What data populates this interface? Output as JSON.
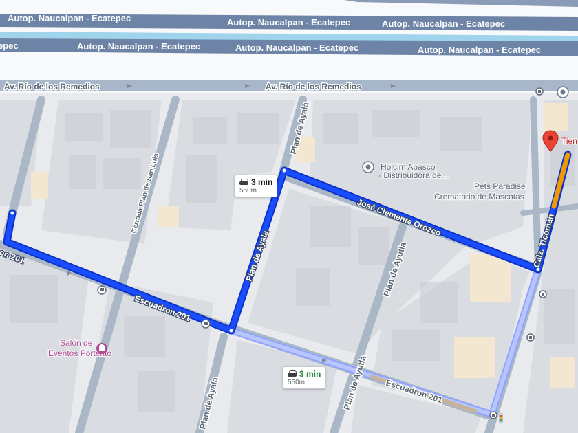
{
  "highway": {
    "label": "Autop. Naucalpan - Ecatepec",
    "label_cut_left": "epec",
    "label_cut_top": "o - Ecatepec"
  },
  "avenue": {
    "label": "Av. Río de los Remedios"
  },
  "streets": {
    "escuadron": "Escuadron 201",
    "escuadron_left": "on 201",
    "plan_de_ayala": "Plan de Ayala",
    "plan_de_ayutla": "Plan de Ayutla",
    "cerrada": "Cerrada Plan de San Luis",
    "jose_clemente": "José Clemente Orozco",
    "calz_ticoman": "Calz. Ticomán"
  },
  "places": {
    "holcim_line1": "Holcim Apasco",
    "holcim_line2": "- Distribuidora de...",
    "pets_line1": "Pets Paradise",
    "pets_line2": "Crematorio de Mascotas",
    "salon_line1": "Salón de",
    "salon_line2": "Eventos Portento",
    "destination": "Tien"
  },
  "routes": {
    "main": {
      "time": "3 min",
      "distance": "550m"
    },
    "alt": {
      "time": "3 min",
      "distance": "550m"
    }
  },
  "colors": {
    "route_main": "#1a4dff",
    "route_alt": "#aab8ff",
    "traffic_slow": "#f29900",
    "highway": "#6d84a6",
    "road": "#a7b6c8",
    "block": "#dcdfe4",
    "water": "#9fd4ec",
    "pin": "#ea4335",
    "alt_time": "#188038"
  },
  "icons": [
    "car-icon",
    "bus-stop-icon",
    "place-icon",
    "event-venue-icon",
    "destination-pin-icon",
    "arrow-icon"
  ]
}
